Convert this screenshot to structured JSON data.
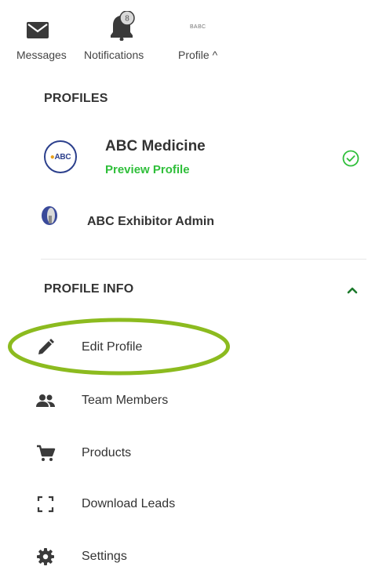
{
  "topnav": {
    "messages_label": "Messages",
    "notifications_label": "Notifications",
    "notifications_count": "8",
    "profile_label": "Profile ^",
    "profile_logo_text": "ВАВС"
  },
  "profiles": {
    "heading": "PROFILES",
    "items": [
      {
        "name": "ABC Medicine",
        "logo_text": "ABC",
        "action_label": "Preview Profile",
        "selected": true,
        "icon": "check-circle-icon"
      },
      {
        "name": "ABC Exhibitor Admin",
        "icon": "user-avatar"
      }
    ]
  },
  "profile_info": {
    "heading": "PROFILE INFO",
    "expanded": true,
    "items": [
      {
        "label": "Edit Profile",
        "icon": "pencil-icon"
      },
      {
        "label": "Team Members",
        "icon": "people-icon"
      },
      {
        "label": "Products",
        "icon": "cart-icon"
      },
      {
        "label": "Download Leads",
        "icon": "scan-frame-icon"
      },
      {
        "label": "Settings",
        "icon": "gear-icon"
      }
    ]
  },
  "colors": {
    "accent_green": "#2fbf3a",
    "highlight_ellipse": "#8cbb1f",
    "abc_blue": "#2b3f8c",
    "text": "#333333"
  }
}
